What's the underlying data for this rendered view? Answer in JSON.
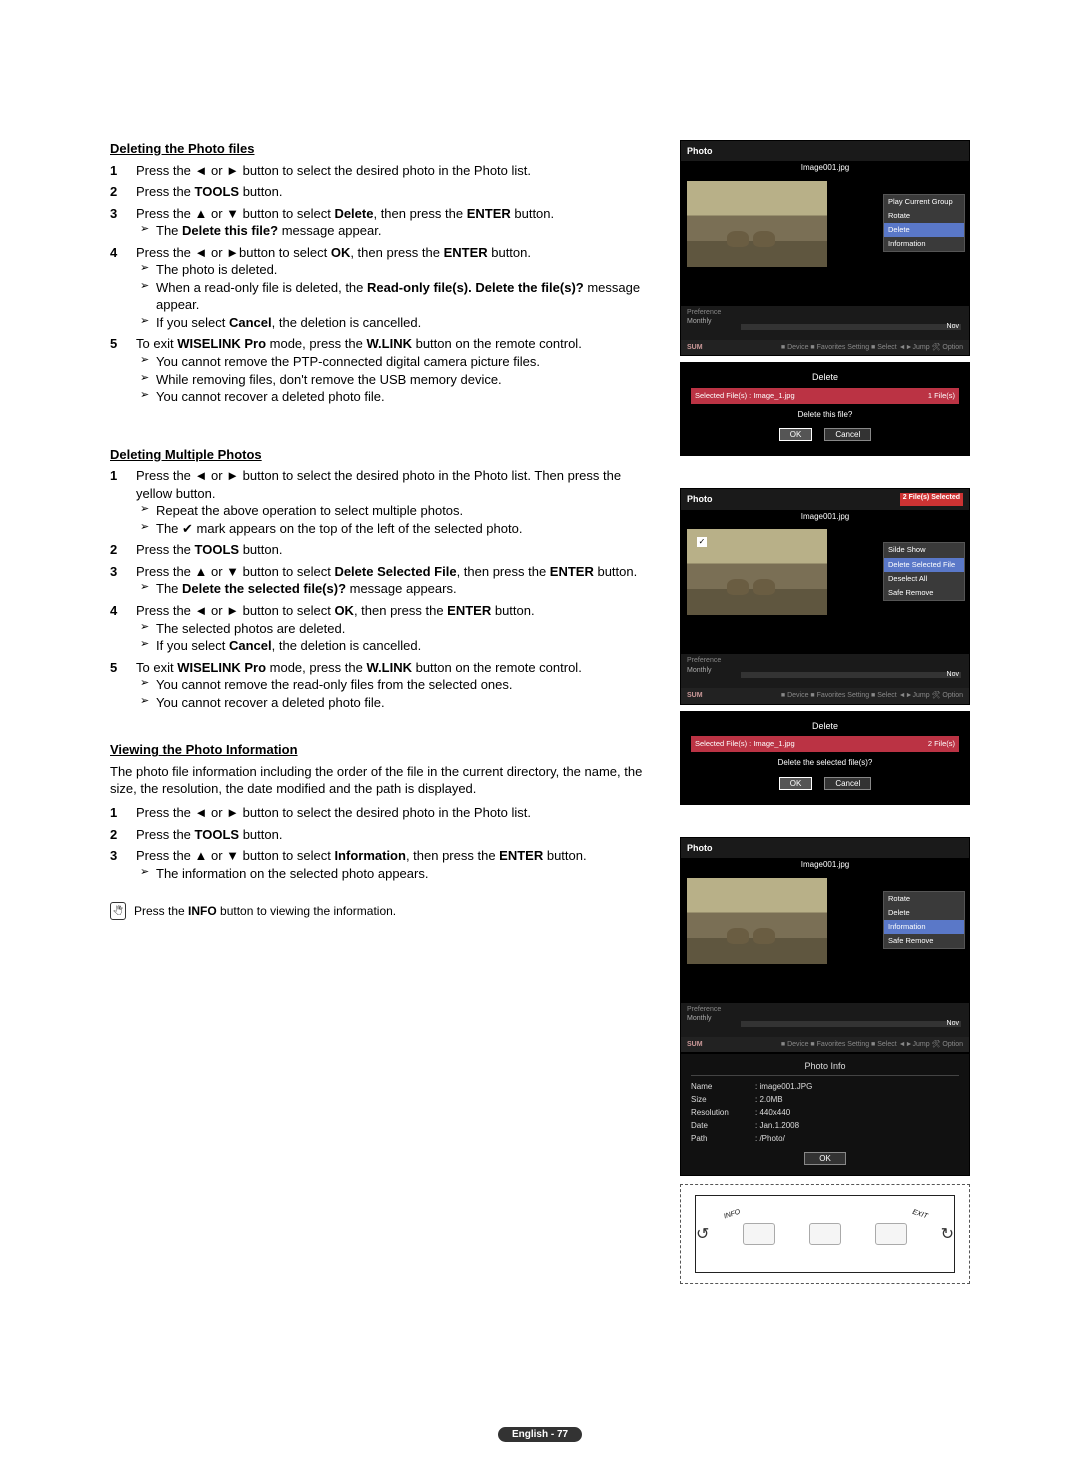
{
  "section1": {
    "heading": "Deleting the Photo files",
    "steps": [
      {
        "num": "1",
        "lines": [
          "Press the ◄ or ► button to select the desired photo in the Photo list."
        ]
      },
      {
        "num": "2",
        "lines": [
          "Press the <b>TOOLS</b> button."
        ]
      },
      {
        "num": "3",
        "lines": [
          "Press the ▲ or ▼ button to select <b>Delete</b>, then press the <b>ENTER</b> button."
        ],
        "subs": [
          "The <b>Delete this file?</b> message appear."
        ]
      },
      {
        "num": "4",
        "lines": [
          "Press the ◄ or ►button to select <b>OK</b>, then press the <b>ENTER</b> button."
        ],
        "subs": [
          "The photo is deleted.",
          "When a read-only file is deleted, the <b>Read-only file(s). Delete the file(s)?</b> message appear.",
          "If you select <b>Cancel</b>, the deletion is cancelled."
        ]
      },
      {
        "num": "5",
        "lines": [
          "To exit <b>WISELINK Pro</b> mode, press the <b>W.LINK</b> button on the remote control."
        ],
        "subs": [
          "You cannot remove the PTP-connected digital camera picture files.",
          "While removing files, don't remove the USB memory device.",
          "You cannot recover a deleted photo file."
        ]
      }
    ]
  },
  "section2": {
    "heading": "Deleting Multiple Photos",
    "steps": [
      {
        "num": "1",
        "lines": [
          "Press the ◄ or ► button to select the desired photo in the Photo list. Then press the yellow button."
        ],
        "subs": [
          "Repeat the above operation to select multiple photos.",
          "The ✔ mark appears on the top of the left of the selected photo."
        ]
      },
      {
        "num": "2",
        "lines": [
          "Press the <b>TOOLS</b> button."
        ]
      },
      {
        "num": "3",
        "lines": [
          "Press the ▲ or ▼ button to select <b>Delete Selected File</b>, then press the <b>ENTER</b> button."
        ],
        "subs": [
          "The <b>Delete the selected file(s)?</b> message appears."
        ]
      },
      {
        "num": "4",
        "lines": [
          "Press the ◄ or ► button to select <b>OK</b>, then press the <b>ENTER</b> button."
        ],
        "subs": [
          "The selected photos are deleted.",
          "If you select <b>Cancel</b>, the deletion is cancelled."
        ]
      },
      {
        "num": "5",
        "lines": [
          "To exit <b>WISELINK Pro</b> mode, press the <b>W.LINK</b> button on the remote control."
        ],
        "subs": [
          "You cannot remove the read-only files from the selected ones.",
          "You cannot recover a deleted photo file."
        ]
      }
    ]
  },
  "section3": {
    "heading": "Viewing the Photo Information",
    "intro": "The photo file information including the order of the file in the current directory, the name, the size, the resolution, the date modified and the path is displayed.",
    "steps": [
      {
        "num": "1",
        "lines": [
          "Press the ◄ or ► button to select the desired photo in the Photo list."
        ]
      },
      {
        "num": "2",
        "lines": [
          "Press the <b>TOOLS</b> button."
        ]
      },
      {
        "num": "3",
        "lines": [
          "Press the ▲ or ▼ button to select <b>Information</b>, then press the <b>ENTER</b> button."
        ],
        "subs": [
          "The information on the selected photo appears."
        ]
      }
    ],
    "note": "Press the <b>INFO</b> button to viewing the information."
  },
  "shot_header": "Photo",
  "img_filename": "Image001.jpg",
  "menu1": {
    "items": [
      "Play Current Group",
      "Rotate",
      "Delete",
      "Information"
    ],
    "highlight": "Delete"
  },
  "timeline_label": "Monthly",
  "timeline_now": "Nov",
  "footer_sum": "SUM",
  "footer_hints": "■ Device ■ Favorites Setting ■ Select ◄►Jump 🛠 Option",
  "dialog1": {
    "title": "Delete",
    "selbar_left": "Selected File(s) : Image_1.jpg",
    "selbar_right": "1 File(s)",
    "msg": "Delete this file?",
    "ok": "OK",
    "cancel": "Cancel"
  },
  "shot2_badge": "2 File(s) Selected",
  "menu2": {
    "items": [
      "Silde Show",
      "Delete Selected File",
      "Deselect All",
      "Safe Remove"
    ],
    "highlight": "Delete Selected File"
  },
  "dialog2": {
    "title": "Delete",
    "selbar_left": "Selected File(s) : Image_1.jpg",
    "selbar_right": "2 File(s)",
    "msg": "Delete the selected file(s)?",
    "ok": "OK",
    "cancel": "Cancel"
  },
  "menu3": {
    "items": [
      "Rotate",
      "Delete",
      "Information",
      "Safe Remove"
    ],
    "highlight": "Information"
  },
  "photoinfo": {
    "title": "Photo Info",
    "rows": [
      {
        "k": "Name",
        "v": ": image001.JPG"
      },
      {
        "k": "Size",
        "v": ": 2.0MB"
      },
      {
        "k": "Resolution",
        "v": ": 440x440"
      },
      {
        "k": "Date",
        "v": ": Jan.1.2008"
      },
      {
        "k": "Path",
        "v": ": /Photo/"
      }
    ],
    "ok": "OK"
  },
  "remote": {
    "l1": "INFO",
    "l2": "EXIT"
  },
  "page_foot": "English - 77"
}
